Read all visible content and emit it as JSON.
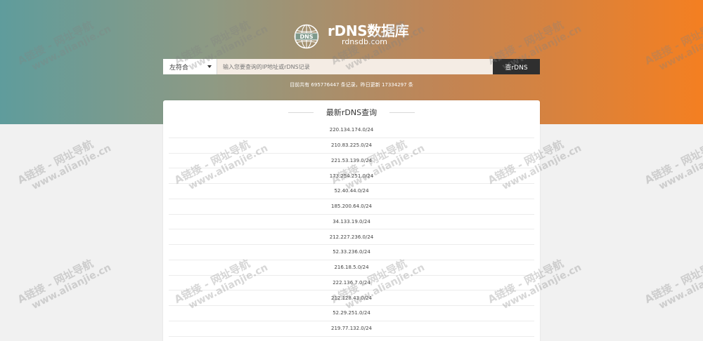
{
  "theme": {
    "hero_gradient": [
      "#5f9c9c",
      "#8e9a84",
      "#c08556",
      "#f47f21"
    ],
    "page_background": "#f1f1f1",
    "button_color": "#2f2f2f"
  },
  "brand": {
    "title": "rDNS数据库",
    "subtitle": "rdnsdb.com",
    "logo_icon": "globe-dns-icon",
    "logo_icon_text": "DNS"
  },
  "search": {
    "match_mode": "左符合",
    "placeholder": "输入您要查询的IP地址或rDNS记录",
    "value": "",
    "button_label": "查rDNS"
  },
  "stats": {
    "text": "目前共有 695776447 条记录，昨日更新 17334297 条"
  },
  "latest": {
    "title": "最新rDNS查询",
    "items": [
      "220.134.174.0/24",
      "210.83.225.0/24",
      "221.53.139.0/24",
      "173.254.251.0/24",
      "52.40.44.0/24",
      "185.200.64.0/24",
      "34.133.19.0/24",
      "212.227.236.0/24",
      "52.33.236.0/24",
      "216.18.5.0/24",
      "222.136.7.0/24",
      "212.128.43.0/24",
      "52.29.251.0/24",
      "219.77.132.0/24"
    ]
  },
  "watermark": {
    "line1": "A链接 - 网址导航",
    "line2": "www.alianjie.cn"
  }
}
